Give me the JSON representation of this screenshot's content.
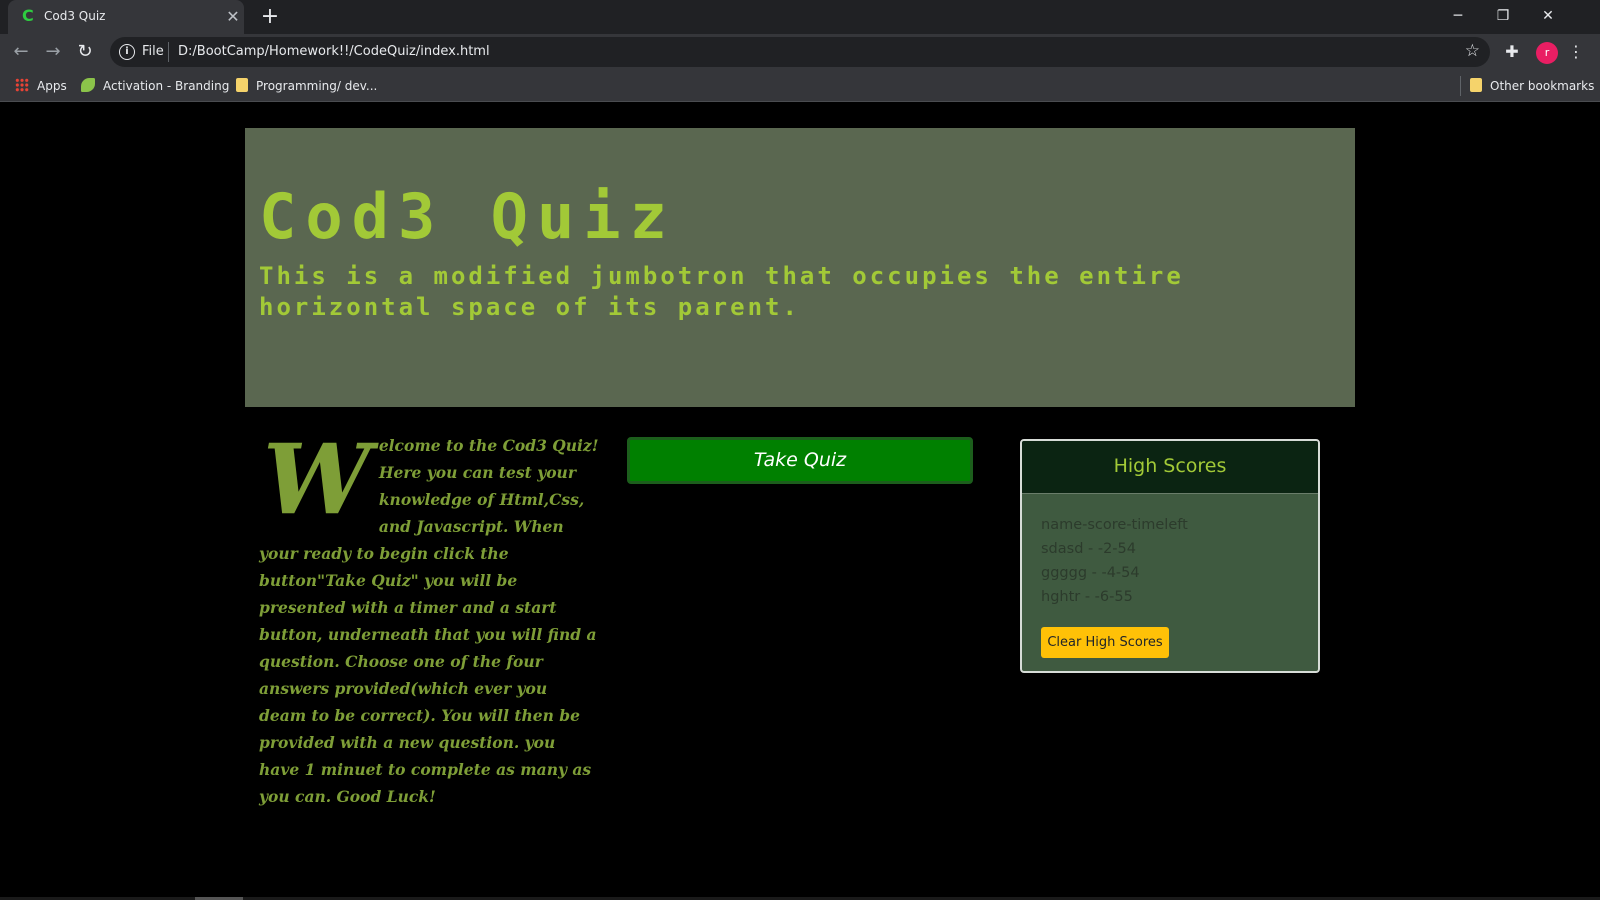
{
  "browser": {
    "tab_title": "Cod3 Quiz",
    "tab_favicon": "C",
    "scheme_label": "File",
    "url": "D:/BootCamp/Homework!!/CodeQuiz/index.html",
    "profile_initial": "r",
    "icons": [
      "back-icon",
      "forward-icon",
      "reload-icon",
      "info-icon",
      "star-icon",
      "extensions-icon",
      "menu-icon",
      "close-icon",
      "plus-icon"
    ],
    "bookmarks": [
      {
        "label": "Apps",
        "icon": "apps-grid-icon"
      },
      {
        "label": "Activation - Branding",
        "icon": "leaf-icon"
      },
      {
        "label": "Programming/ dev...",
        "icon": "folder-icon"
      }
    ],
    "other_bookmarks": "Other bookmarks"
  },
  "jumbotron": {
    "title": "Cod3 Quiz",
    "subtitle": "This is a modified jumbotron that occupies the entire horizontal space of its parent."
  },
  "welcome": {
    "dropcap": "W",
    "text": "elcome to the Cod3 Quiz! Here you can test your knowledge of Html,Css, and Javascript. When your ready to begin click the button\"Take Quiz\" you will be presented with a timer and a start button, underneath that you will find a question. Choose one of the four answers provided(which ever you deam to be correct). You will then be provided with a new question. you have 1 minuet to complete as many as you can. Good Luck!"
  },
  "quiz": {
    "take_quiz_label": "Take Quiz"
  },
  "scores": {
    "title": "High Scores",
    "lines": [
      "name-score-timeleft",
      "sdasd - -2-54",
      "ggggg - -4-54",
      "hghtr - -6-55"
    ],
    "clear_label": "Clear High Scores"
  },
  "colors": {
    "page_bg": "#000000",
    "jumbotron_bg": "#5a6750",
    "accent_green": "#a2c937",
    "button_green": "#008000",
    "scores_bg": "#3f5a40",
    "clear_button": "#ffc107"
  }
}
